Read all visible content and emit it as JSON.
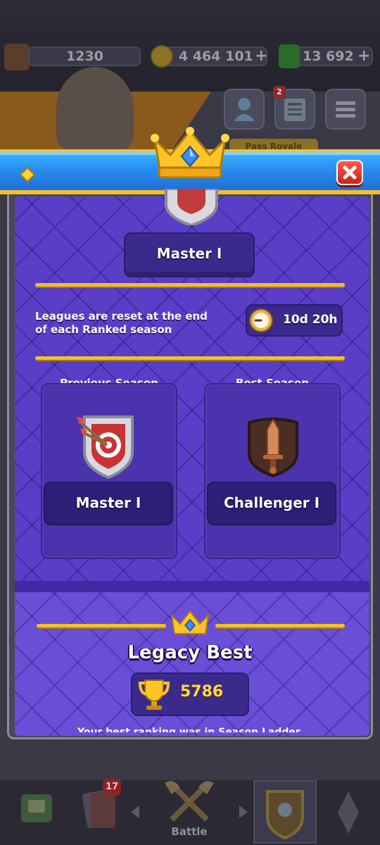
{
  "top_bar": {
    "level_value": "1230",
    "gold_value": "4 464 101",
    "gold_plus": "+",
    "gems_value": "13 692",
    "gems_plus": "+",
    "news_badge": "2",
    "pass_label": "Pass Royale"
  },
  "modal": {
    "current_league": "Master I",
    "reset_info": "Leagues are reset at the end of each Ranked season",
    "timer": "10d 20h",
    "previous_season": {
      "heading": "Previous Season",
      "league": "Master I"
    },
    "best_season": {
      "heading": "Best Season",
      "league": "Challenger I"
    },
    "legacy": {
      "title": "Legacy Best",
      "trophies": "5786",
      "footer_partial": "Your best ranking was in Season Ladder"
    }
  },
  "bottom_nav": {
    "cards_badge": "17",
    "battle_label": "Battle"
  },
  "colors": {
    "header_blue": "#2a8df0",
    "gold_accent": "#f2c02a",
    "panel_purple": "#5b3ec8",
    "close_red": "#d8322a"
  }
}
